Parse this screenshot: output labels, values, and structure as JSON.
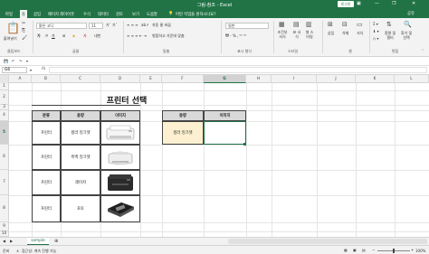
{
  "window": {
    "title": "그림-참조 - Excel",
    "login_label": "로그인",
    "minimize": "—",
    "restore": "❐",
    "close": "✕"
  },
  "ribbon_tabs": [
    "파일",
    "홈",
    "삽입",
    "페이지 레이아웃",
    "수식",
    "데이터",
    "검토",
    "보기",
    "도움말"
  ],
  "ribbon_active": "홈",
  "tell_me": "어떤 작업을 원하시나요?",
  "share": "공유",
  "ribbon": {
    "paste": "붙여넣기",
    "font_name": "맑은 고딕",
    "font_size": "11",
    "wrap_text": "자동 줄 바꿈",
    "merge_center": "병합하고 가운데 맞춤",
    "number_format": "일반",
    "conditional_format": "조건부 서식",
    "format_table": "표 서식",
    "cell_styles": "셀 스타일",
    "insert": "삽입",
    "delete": "삭제",
    "format": "서식",
    "sort_filter": "정렬 및 필터",
    "find_select": "찾기 및 선택",
    "groups": {
      "clipboard": "클립보드",
      "font": "글꼴",
      "alignment": "맞춤",
      "number": "표시 형식",
      "styles": "스타일",
      "cells": "셀",
      "editing": "편집"
    }
  },
  "formula_bar": {
    "name_box": "G6",
    "fx": "fx",
    "value": ""
  },
  "columns": [
    "A",
    "B",
    "C",
    "D",
    "E",
    "F",
    "G",
    "H",
    "I",
    "J",
    "K",
    "L"
  ],
  "rows": [
    "1",
    "2",
    "3",
    "4",
    "5",
    "6",
    "7",
    "8",
    "9",
    "10"
  ],
  "sheet_title": "프린터 선택",
  "table": {
    "headers": [
      "분류",
      "용량",
      "이미지"
    ],
    "rows": [
      {
        "category": "프린터",
        "type": "컬러 잉크젯"
      },
      {
        "category": "프린터",
        "type": "흑백 잉크젯"
      },
      {
        "category": "프린터",
        "type": "레이저"
      },
      {
        "category": "프린터",
        "type": "포토"
      }
    ]
  },
  "lookup": {
    "headers": [
      "용량",
      "이미지"
    ],
    "value": "컬러 잉크젯"
  },
  "sheet_tab": "sample",
  "status": {
    "ready": "준비",
    "accessibility": "접근성: 계속 진행 가능",
    "zoom": "100%"
  },
  "colors": {
    "excel_green": "#217346",
    "highlight": "#fdf0d0"
  }
}
